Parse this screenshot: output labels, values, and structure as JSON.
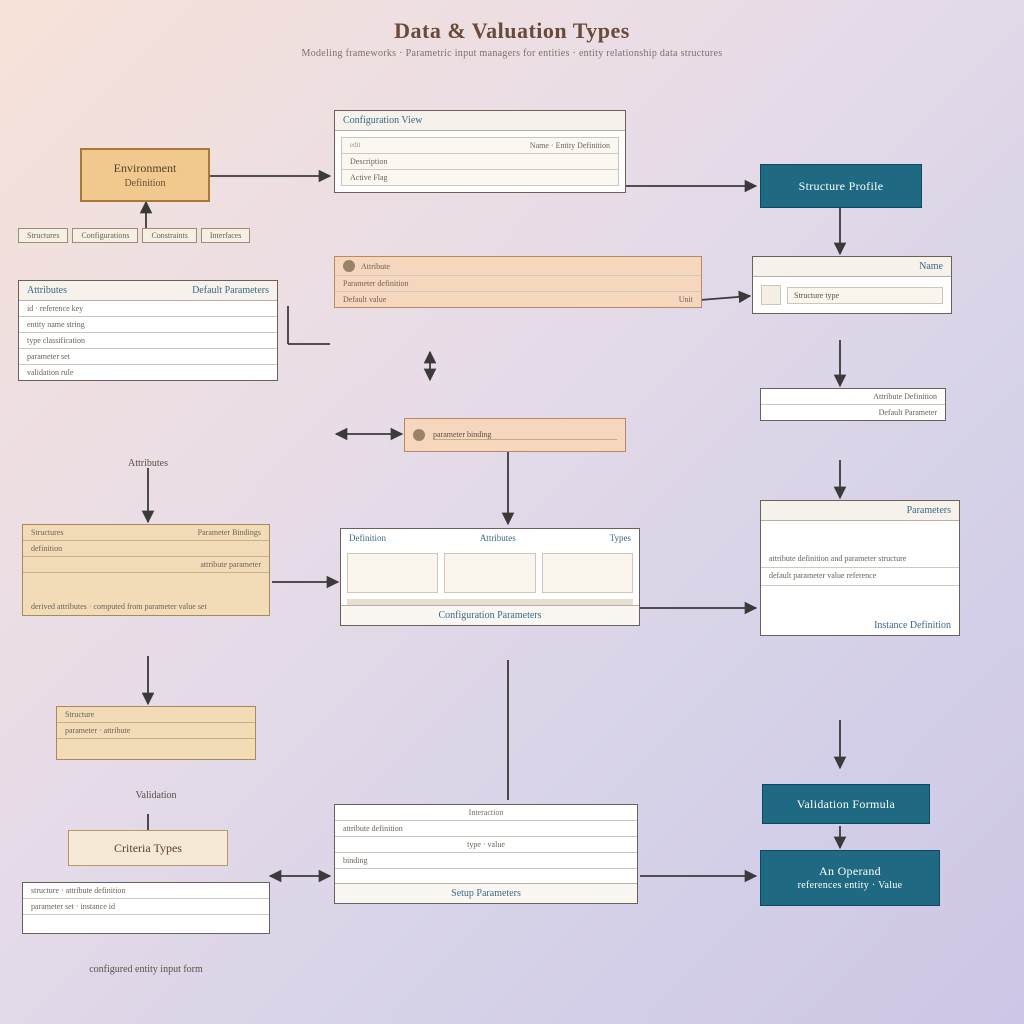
{
  "title": "Data & Valuation Types",
  "subtitle": "Modeling frameworks · Parametric input managers for entities · entity relationship data structures",
  "nodes": {
    "env": {
      "label": "Environment",
      "sub": "Definition"
    },
    "tabs": [
      "Structures",
      "Configurations",
      "Constraints",
      "Interfaces"
    ],
    "list_left": {
      "header": [
        "Attributes",
        "Default Parameters"
      ],
      "rows": [
        "id · reference key",
        "entity name string",
        "type classification",
        "parameter set",
        "validation rule"
      ],
      "footer": "Attributes"
    },
    "form_top": {
      "header": "Configuration View",
      "rows": [
        "Name · Entity Definition",
        "Description",
        "Active Flag"
      ],
      "note": "edit"
    },
    "form_mid": {
      "header": "",
      "rows": [
        "Attribute",
        "Parameter definition",
        "Default value",
        "Unit"
      ],
      "icon": "user-icon"
    },
    "wide_small": {
      "rows": [
        "parameter binding"
      ],
      "icon": "user-icon"
    },
    "panel_mid": {
      "header_left": "Definition",
      "header_mid": "Attributes",
      "header_right": "Types",
      "footer": "Configuration Parameters"
    },
    "left_tan2": {
      "header": [
        "Structures",
        "Parameter Bindings"
      ],
      "rows": [
        "definition",
        "attribute parameter"
      ],
      "mid": "derived attributes · computed from parameter value set"
    },
    "left_tan3": {
      "rows": [
        "Structure",
        "parameter · attribute"
      ],
      "footer": "Validation"
    },
    "criteria": {
      "label": "Criteria Types"
    },
    "bottom_left": {
      "rows": [
        "structure · attribute definition",
        "parameter set · instance id"
      ],
      "footer": "configured entity input form"
    },
    "bottom_mid": {
      "header": "Interaction",
      "rows": [
        "attribute definition",
        "type · value",
        "binding"
      ],
      "footer": "Setup Parameters"
    },
    "teal1": "Structure Profile",
    "right_panel1": {
      "header": "Name",
      "rows": [
        "Structure type"
      ]
    },
    "right_panel2": {
      "rows": [
        "Attribute Definition",
        "Default Parameter"
      ]
    },
    "right_panel3": {
      "header": "Parameters",
      "rows": [
        "attribute definition and parameter structure",
        "default parameter value reference"
      ],
      "footer": "Instance Definition"
    },
    "teal2": "Validation Formula",
    "teal3": {
      "line1": "An Operand",
      "line2": "references entity · Value"
    }
  },
  "colors": {
    "teal": "#1f6a82",
    "tan": "#f2dcb8",
    "peach": "#f6d7bd"
  }
}
